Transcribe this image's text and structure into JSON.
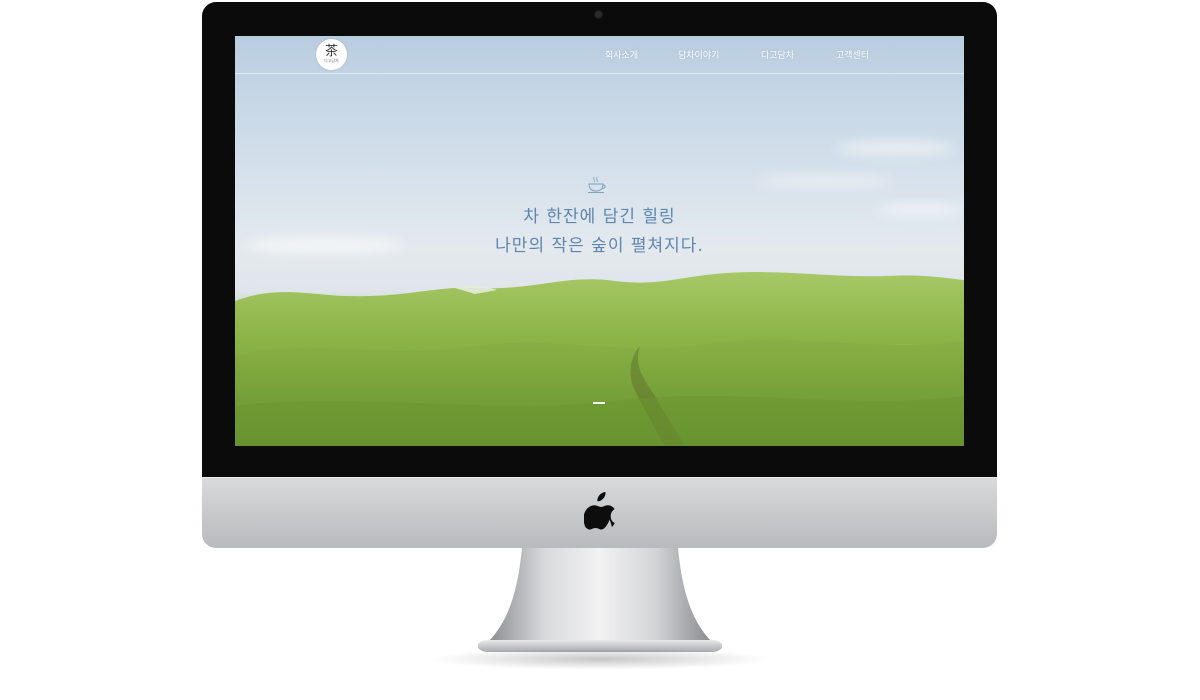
{
  "site": {
    "logo": {
      "char": "茶",
      "subtext": "다고담차"
    },
    "nav": [
      {
        "label": "회사소개"
      },
      {
        "label": "담차이야기"
      },
      {
        "label": "다고담차"
      },
      {
        "label": "고객센터"
      }
    ],
    "hero": {
      "icon": "teacup-icon",
      "line1": "차 한잔에 담긴 힐링",
      "line2": "나만의 작은 숲이 펼쳐지다."
    }
  },
  "colors": {
    "hero_text": "#5e86ae",
    "nav_text": "#ffffff",
    "bezel": "#0b0b0b",
    "chin": "#c7c8ca"
  }
}
